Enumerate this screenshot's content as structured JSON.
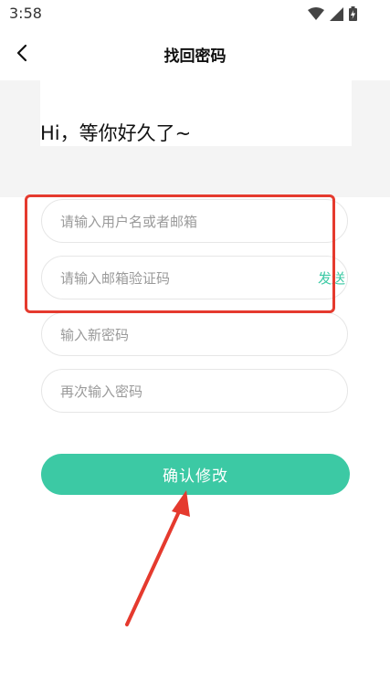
{
  "status_bar": {
    "time": "3:58"
  },
  "header": {
    "title": "找回密码"
  },
  "greeting": "Hi，等你好久了~",
  "form": {
    "username_placeholder": "请输入用户名或者邮箱",
    "code_placeholder": "请输入邮箱验证码",
    "send_label": "发送",
    "new_password_placeholder": "输入新密码",
    "confirm_password_placeholder": "再次输入密码",
    "submit_label": "确认修改"
  },
  "colors": {
    "accent": "#3cc9a4",
    "annotation": "#e53a2e",
    "band": "#f4f4f4"
  },
  "icons": [
    "back-arrow-icon",
    "wifi-icon",
    "signal-icon",
    "battery-icon"
  ]
}
